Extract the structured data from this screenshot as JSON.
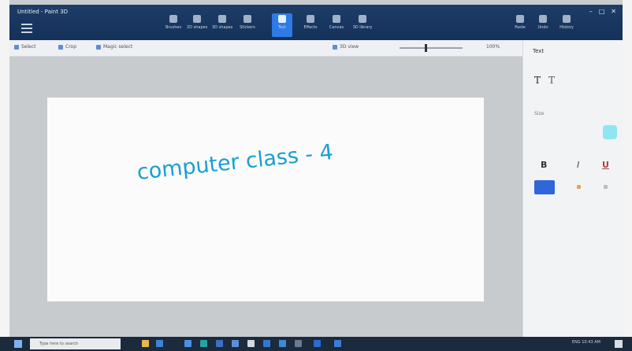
{
  "window": {
    "title": "Untitled - Paint 3D",
    "controls": [
      "–",
      "□",
      "✕"
    ]
  },
  "ribbon": {
    "tools": [
      {
        "label": "Brushes",
        "icon": "brush-icon"
      },
      {
        "label": "2D shapes",
        "icon": "shapes-2d-icon"
      },
      {
        "label": "3D shapes",
        "icon": "shapes-3d-icon"
      },
      {
        "label": "Stickers",
        "icon": "sticker-icon"
      },
      {
        "label": "Text",
        "icon": "text-icon",
        "active": true
      },
      {
        "label": "Effects",
        "icon": "effects-icon"
      },
      {
        "label": "Canvas",
        "icon": "canvas-icon"
      },
      {
        "label": "3D library",
        "icon": "library-icon"
      }
    ],
    "right_tools": [
      {
        "label": "Paste",
        "icon": "paste-icon"
      },
      {
        "label": "Undo",
        "icon": "undo-icon"
      },
      {
        "label": "History",
        "icon": "history-icon"
      }
    ]
  },
  "command_bar": {
    "select_label": "Select",
    "crop_label": "Crop",
    "magic_select_label": "Magic select",
    "view_label": "3D view",
    "zoom_value": "100%",
    "zoom_level": 0.4
  },
  "canvas": {
    "text": "computer class - 4",
    "text_color": "#1a9fd4"
  },
  "panel": {
    "title": "Text",
    "font_label": "Size",
    "bold": "B",
    "italic": "I",
    "underline": "U",
    "accent": "#8fe6f0",
    "selected_color": "#2f66d8"
  },
  "taskbar": {
    "search_placeholder": "Type here to search",
    "tray_text": "ENG  10:43 AM"
  }
}
